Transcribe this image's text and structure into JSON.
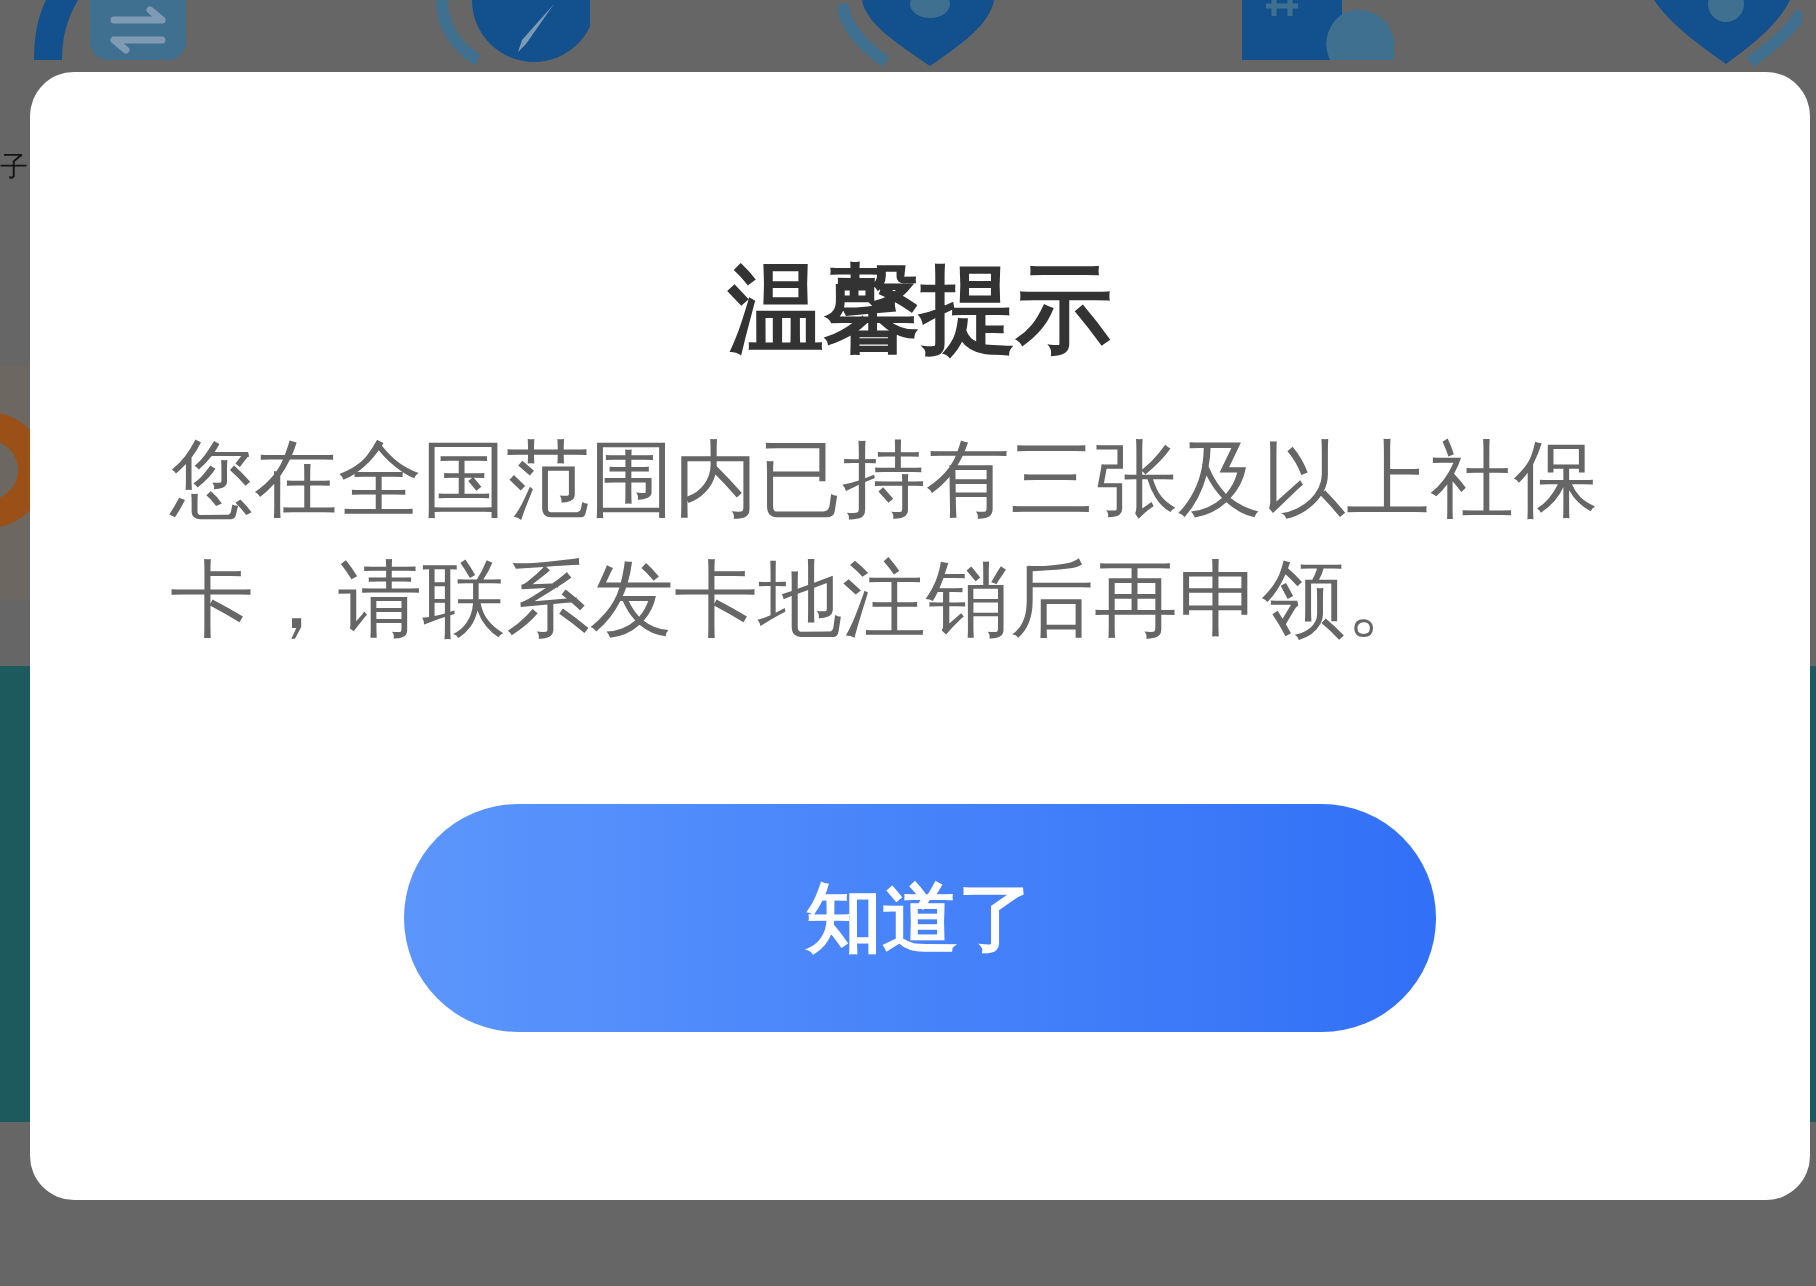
{
  "background": {
    "side_text": "子"
  },
  "dialog": {
    "title": "温馨提示",
    "message": "您在全国范围内已持有三张及以上社保卡，请联系发卡地注销后再申领。",
    "button": "知道了"
  }
}
